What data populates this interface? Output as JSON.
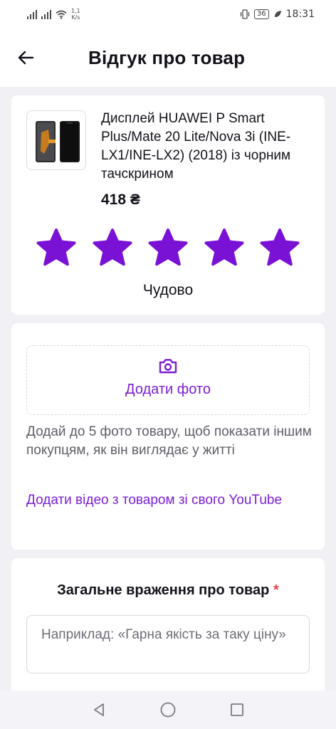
{
  "status_bar": {
    "net_speed_value": "1,1",
    "net_speed_unit": "K/s",
    "battery": "36",
    "time": "18:31"
  },
  "header": {
    "title": "Відгук про товар",
    "back_icon": "arrow-left-icon"
  },
  "product": {
    "name": "Дисплей HUAWEI P Smart Plus/Mate 20 Lite/Nova 3i (INE-LX1/INE-LX2) (2018) із чорним тачскрином",
    "price": "418 ₴",
    "rating": 5,
    "rating_max": 5,
    "rating_label": "Чудово"
  },
  "photos": {
    "add_photo_label": "Додати фото",
    "hint": "Додай до 5 фото товару, щоб показати іншим покупцям, як він виглядає у житті",
    "video_link": "Додати відео з товаром зі свого YouTube"
  },
  "impression": {
    "title": "Загальне враження про товар",
    "required_mark": "*",
    "placeholder": "Наприклад: «Гарна якість за таку ціну»"
  },
  "colors": {
    "accent": "#7a1fd3",
    "star": "#7a12d6",
    "required": "#e2434b",
    "background": "#f1f0f4"
  },
  "icons": {
    "camera": "camera-icon",
    "star": "star-icon",
    "nav_back": "triangle-back-icon",
    "nav_home": "circle-home-icon",
    "nav_recent": "square-recent-icon"
  }
}
